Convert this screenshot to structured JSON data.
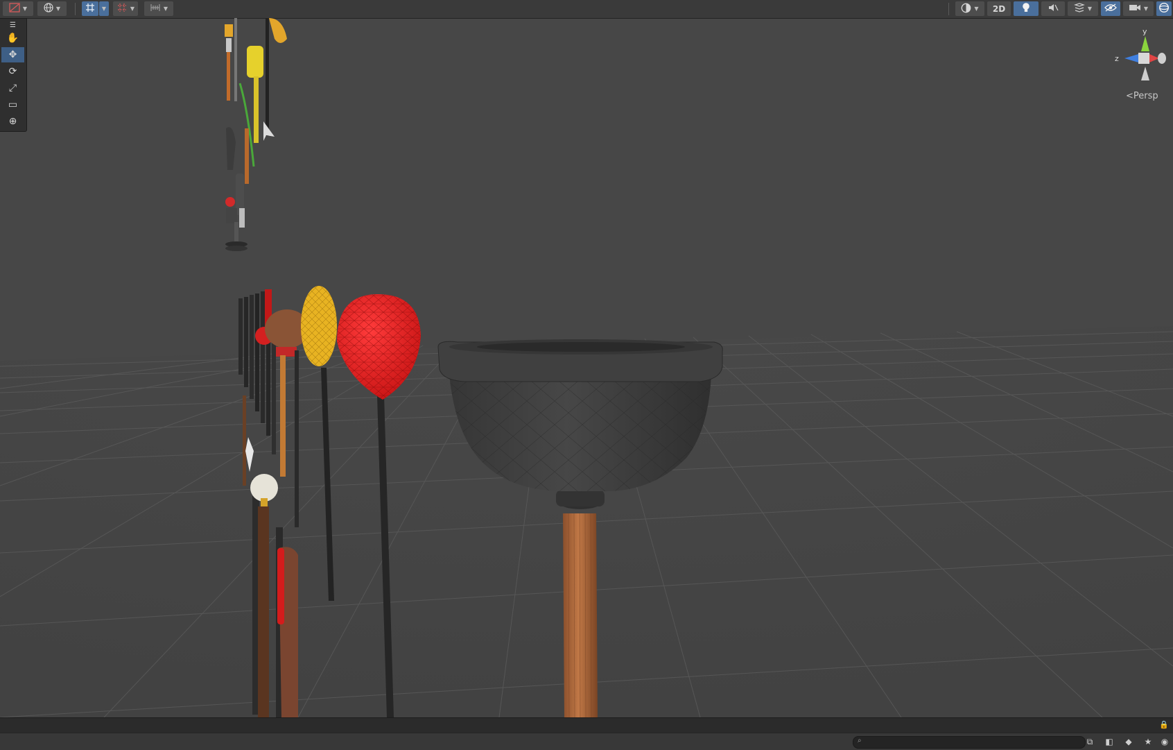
{
  "toolbar": {
    "left_icons": [
      "draw-mode-icon",
      "global-orientation-icon",
      "grid-snap-icon",
      "snap-increment-icon",
      "ruler-icon"
    ],
    "right": {
      "shading_icon": "shading-sphere-icon",
      "mode_2d_label": "2D",
      "lighting_icon": "light-bulb-icon",
      "audio_icon": "audio-icon",
      "effects_icon": "effects-icon",
      "visibility_icon": "visibility-icon",
      "camera_icon": "camera-icon",
      "gizmos_icon": "gizmos-icon"
    }
  },
  "tools": [
    {
      "name": "hand-tool",
      "icon": "✋",
      "active": false
    },
    {
      "name": "move-tool",
      "icon": "✥",
      "active": true
    },
    {
      "name": "rotate-tool",
      "icon": "⟳",
      "active": false
    },
    {
      "name": "scale-tool",
      "icon": "⤢",
      "active": false
    },
    {
      "name": "rect-tool",
      "icon": "▭",
      "active": false
    },
    {
      "name": "transform-tool",
      "icon": "⊕",
      "active": false
    }
  ],
  "gizmo": {
    "y_label": "y",
    "z_label": "z",
    "projection_label": "Persp",
    "colors": {
      "y": "#8ad43e",
      "x": "#e04545",
      "z": "#3f7fe0"
    }
  },
  "colors": {
    "viewport_bg": "#474747",
    "accent": "#4a6f9c",
    "plunger_cup": "#3c3c3c",
    "plunger_handle": "#b06a3e",
    "red_mesh": "#e31f1f",
    "yellow_mesh": "#e8b322"
  }
}
